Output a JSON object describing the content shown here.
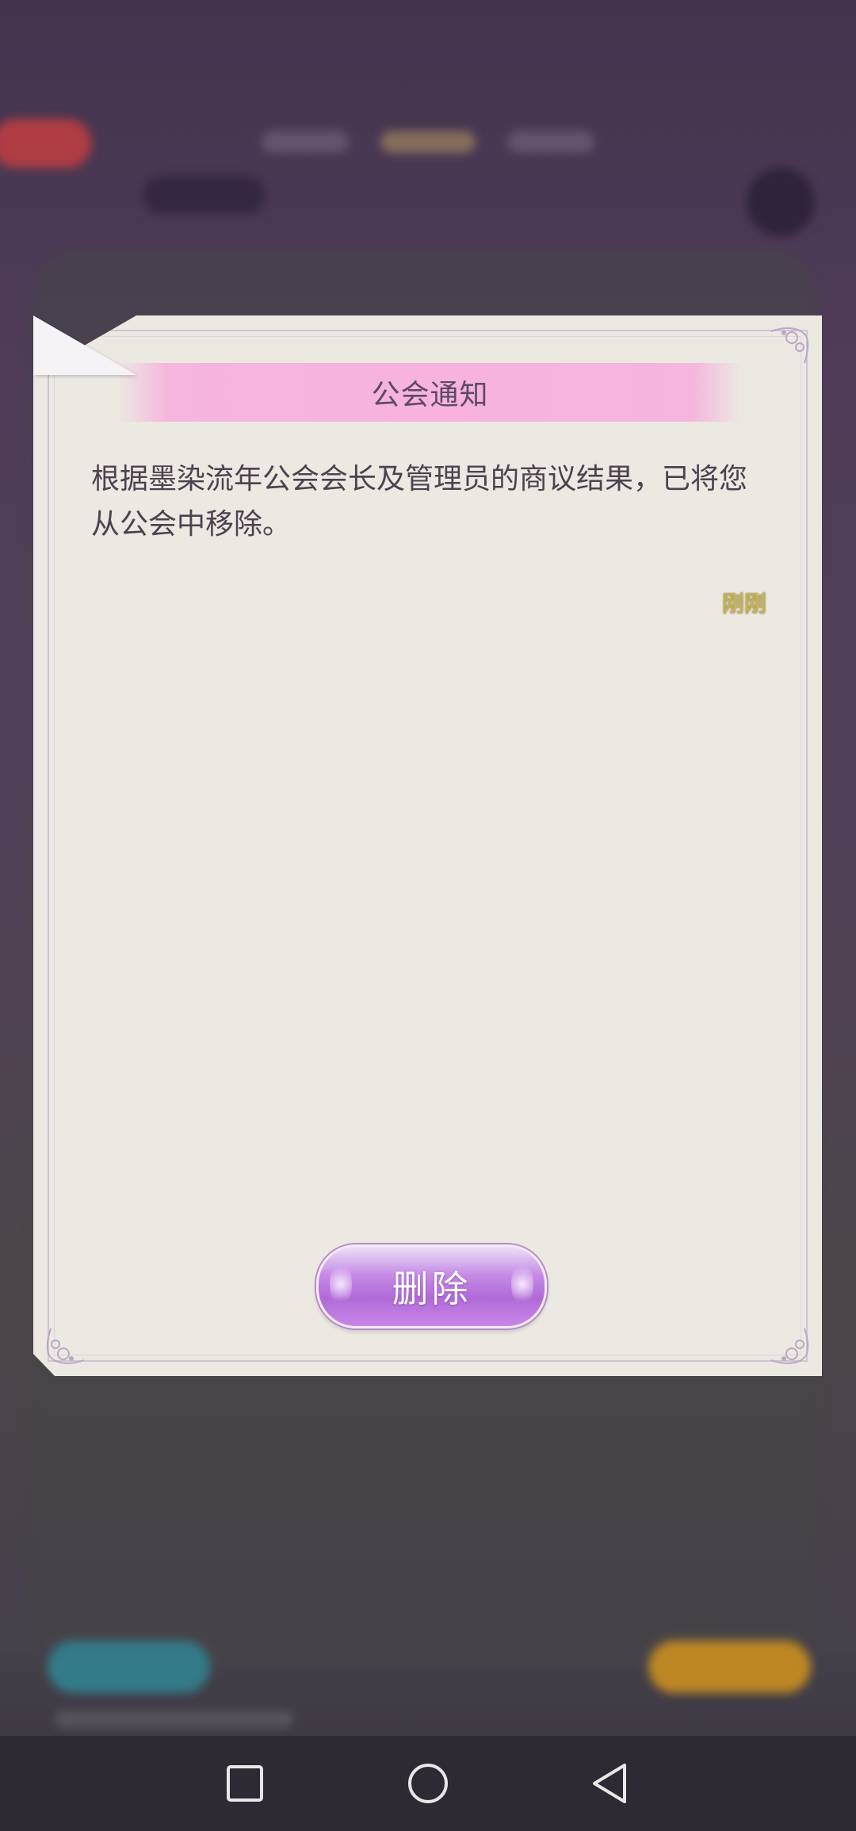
{
  "dialog": {
    "title": "公会通知",
    "message": "根据墨染流年公会会长及管理员的商议结果，已将您从公会中移除。",
    "time": "刚刚",
    "delete_label": "删除"
  },
  "colors": {
    "title_bar": "#f7b2de",
    "button": "#b06ad7",
    "paper": "#ece8e2",
    "time_text": "#c8b24b"
  },
  "navbar": {
    "icons": [
      "recent-apps-icon",
      "home-icon",
      "back-icon"
    ]
  }
}
